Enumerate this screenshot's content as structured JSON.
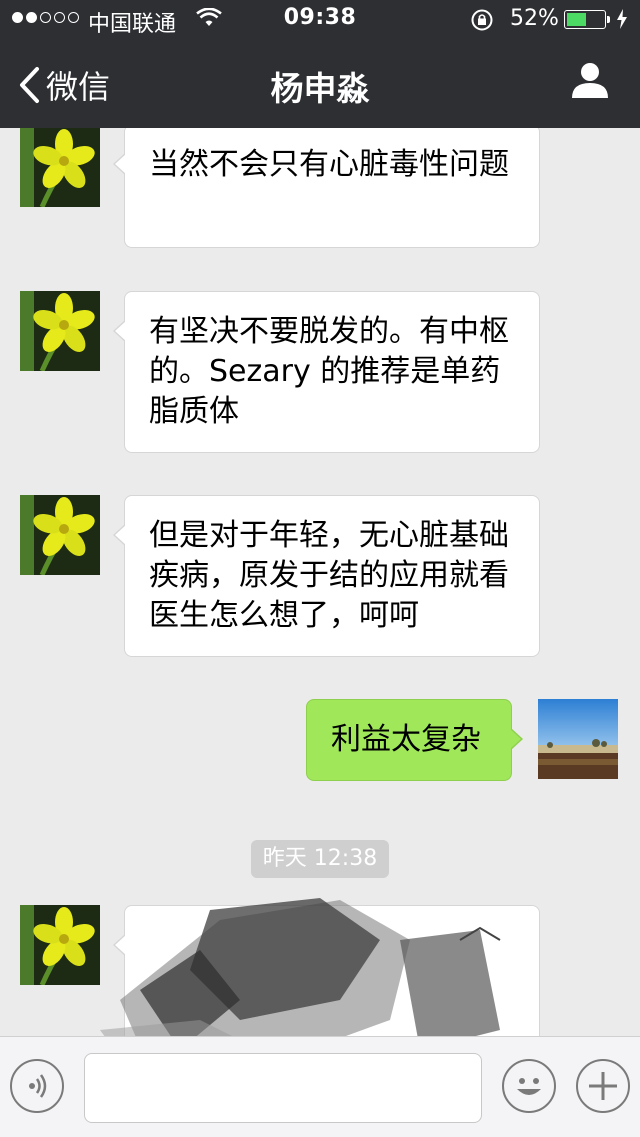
{
  "status_bar": {
    "carrier": "中国联通",
    "time": "09:38",
    "battery_percent": "52%",
    "battery_level": 0.52,
    "signal_dots_filled": 2,
    "signal_dots_total": 5
  },
  "nav": {
    "back_label": "微信",
    "title": "杨申淼"
  },
  "messages": [
    {
      "side": "left",
      "text": "当然不会只有心脏毒性问题"
    },
    {
      "side": "left",
      "text": "有坚决不要脱发的。有中枢的。Sezary 的推荐是单药脂质体"
    },
    {
      "side": "left",
      "text": "但是对于年轻，无心脏基础疾病，原发于结的应用就看医生怎么想了，呵呵"
    },
    {
      "side": "right",
      "text": "利益太复杂"
    },
    {
      "side": "left",
      "text": ""
    }
  ],
  "timestamp": "昨天 12:38",
  "colors": {
    "nav_bg": "#2e2f33",
    "chat_bg": "#ebebeb",
    "my_bubble": "#a0e75a",
    "their_bubble": "#ffffff",
    "battery_fill": "#4cd964"
  },
  "icons": [
    "back-chevron-icon",
    "profile-icon",
    "wifi-icon",
    "lock-rotation-icon",
    "battery-icon",
    "charge-icon",
    "voice-icon",
    "emoji-icon",
    "plus-icon"
  ]
}
